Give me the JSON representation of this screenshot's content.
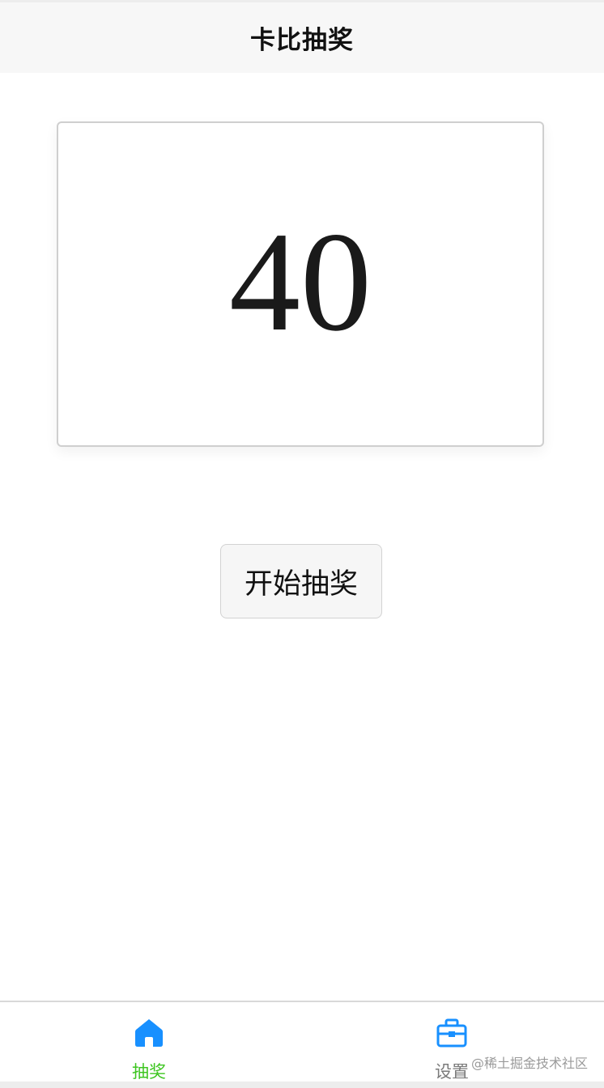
{
  "navbar": {
    "title": "卡比抽奖"
  },
  "lottery": {
    "current_number": "40",
    "start_button_label": "开始抽奖"
  },
  "tabbar": {
    "items": [
      {
        "label": "抽奖",
        "icon": "home-icon",
        "active": true,
        "color": "#3cc51f"
      },
      {
        "label": "设置",
        "icon": "toolbox-icon",
        "active": false,
        "color": "#7a7a7a"
      }
    ],
    "icon_color": "#1890ff"
  },
  "watermark": "@稀土掘金技术社区"
}
